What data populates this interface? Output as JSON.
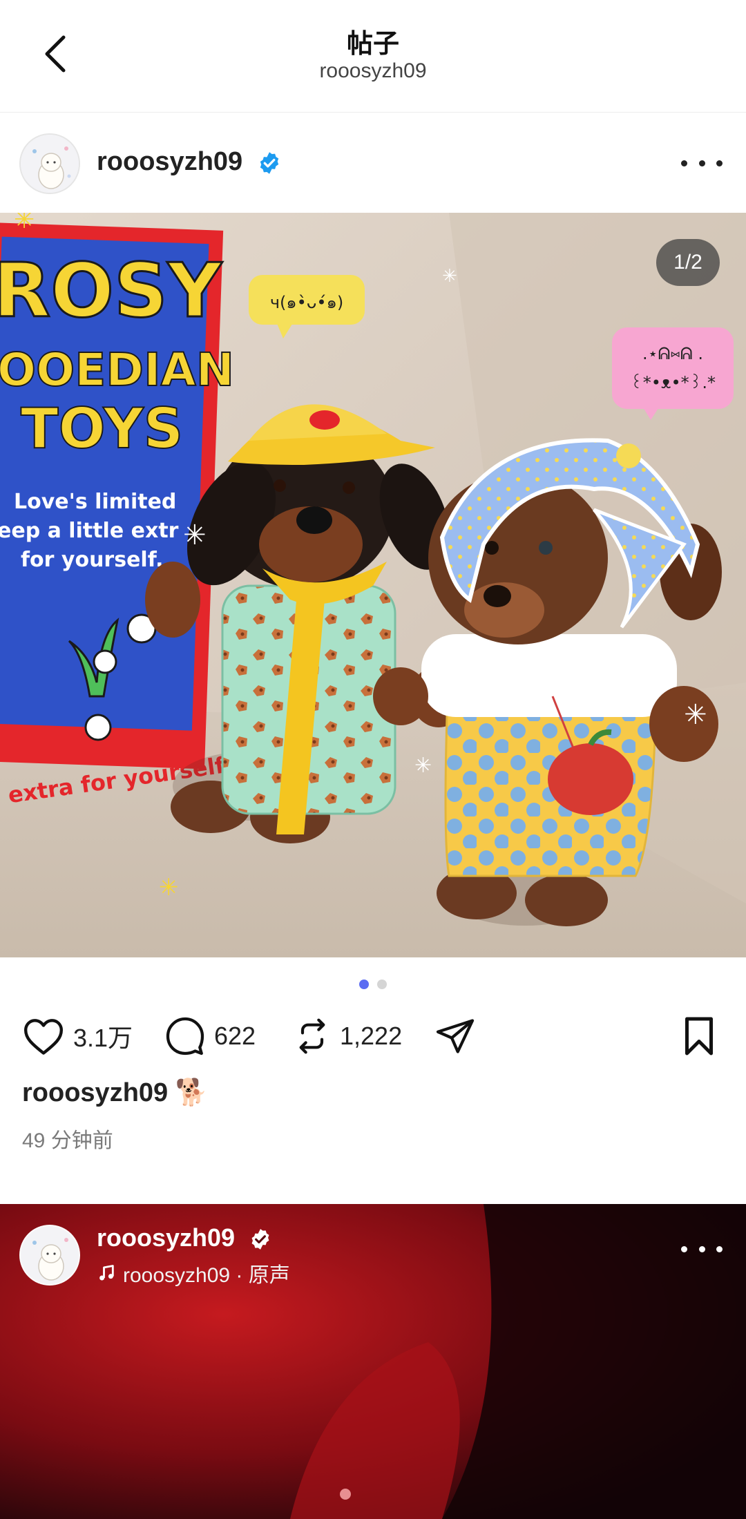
{
  "nav": {
    "title": "帖子",
    "subtitle": "rooosyzh09",
    "back_icon": "chevron-left-icon"
  },
  "post": {
    "username": "rooosyzh09",
    "verified": true,
    "image_counter": "1/2",
    "page_dots": {
      "total": 2,
      "active": 1
    },
    "likes": "3.1万",
    "comments": "622",
    "reposts": "1,222",
    "caption_user": "rooosyzh09",
    "caption_emoji": "🐕",
    "timestamp": "49 分钟前",
    "image_text": {
      "box_line1": "ROSY",
      "box_line2": "OOEDIAN",
      "box_line3": "TOYS",
      "box_tag1": "Love's limited",
      "box_tag2": "eep a little extr",
      "box_tag3": "for yourself.",
      "box_bottom": "extra for yourself.",
      "bubble_left": "ч(๑•̀ᴗ•́๑)",
      "bubble_right_1": ".⋆ᕱ⑅ᕱ .",
      "bubble_right_2": "꒰*•ᴥ•*꒱.*"
    }
  },
  "next_post": {
    "username": "rooosyzh09",
    "verified": true,
    "audio_label": "rooosyzh09 · 原声"
  },
  "colors": {
    "accent_dot": "#5b6cf2",
    "verified_blue": "#1d9bf0",
    "box_red": "#e4262b",
    "box_blue": "#2f52c8",
    "box_yellow": "#f6d535"
  }
}
